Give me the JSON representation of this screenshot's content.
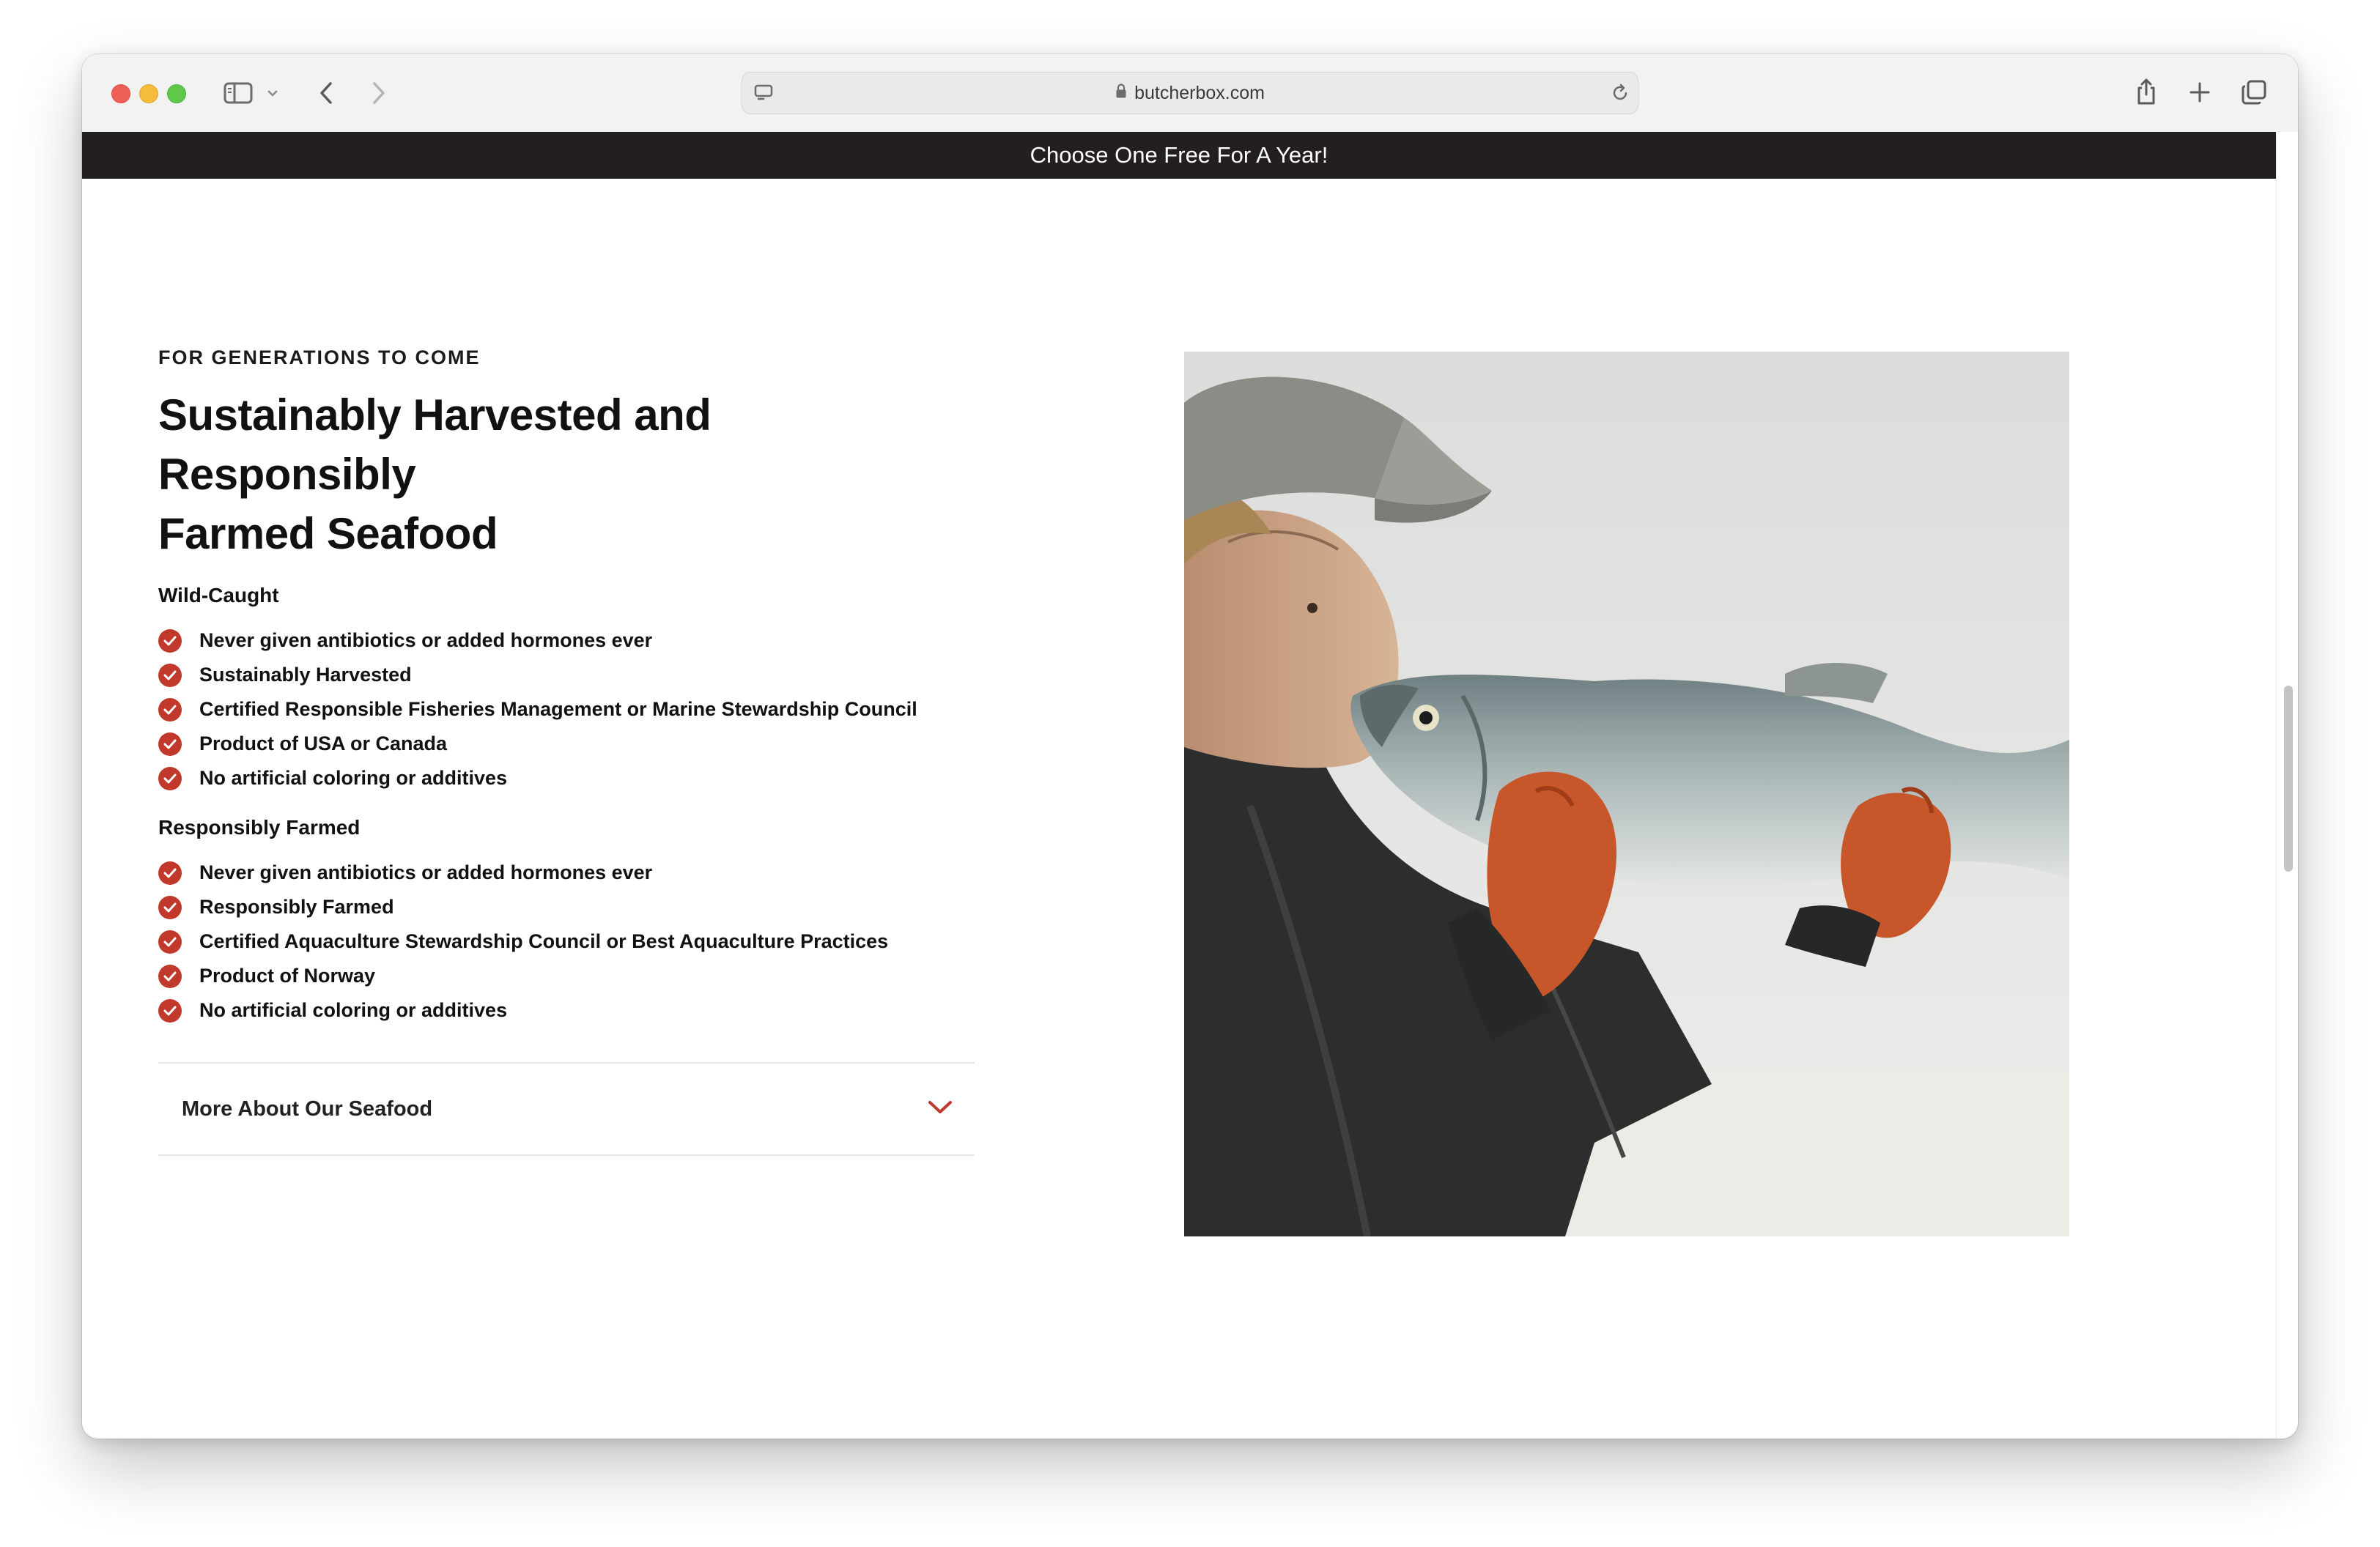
{
  "browser": {
    "url": "butcherbox.com"
  },
  "promo": {
    "text": "Choose One Free For A Year!"
  },
  "section": {
    "eyebrow": "FOR GENERATIONS TO COME",
    "headline_line1": "Sustainably Harvested and Responsibly",
    "headline_line2": "Farmed Seafood",
    "groups": [
      {
        "title": "Wild-Caught",
        "items": [
          "Never given antibiotics or added hormones ever",
          "Sustainably Harvested",
          "Certified Responsible Fisheries Management or Marine Stewardship Council",
          "Product of USA or Canada",
          "No artificial coloring or additives"
        ]
      },
      {
        "title": "Responsibly Farmed",
        "items": [
          "Never given antibiotics or added hormones ever",
          "Responsibly Farmed",
          "Certified Aquaculture Stewardship Council or Best Aquaculture Practices",
          "Product of Norway",
          "No artificial coloring or additives"
        ]
      }
    ],
    "accordion_label": "More About Our Seafood"
  },
  "colors": {
    "accent": "#c0392b",
    "promo_bar": "#231f1e"
  }
}
